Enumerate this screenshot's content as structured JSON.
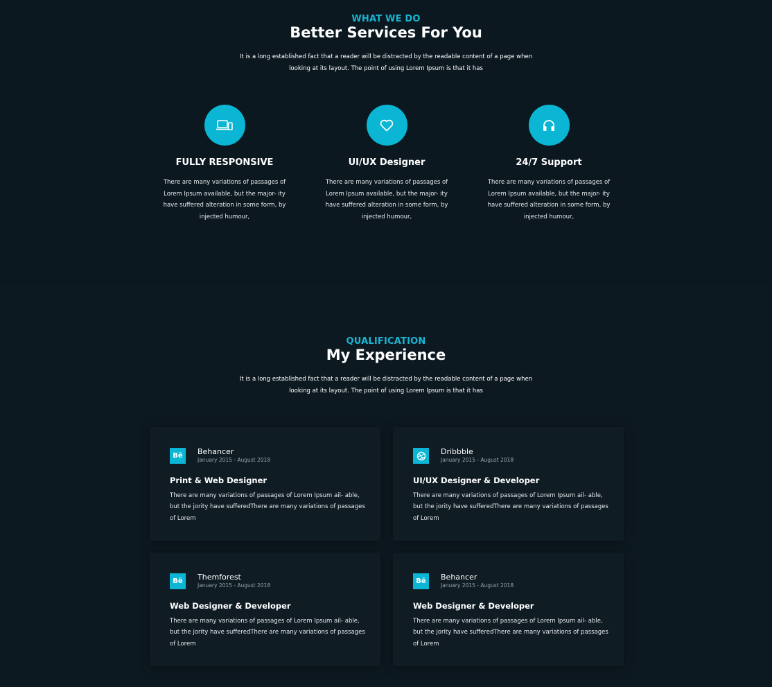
{
  "services_section": {
    "eyebrow": "WHAT WE DO",
    "heading": "Better Services For You",
    "lead_line1": "It is a long established fact that a reader will be distracted by the readable content of a page when",
    "lead_line2": "looking at its layout. The point of using Lorem Ipsum is that it has",
    "items": [
      {
        "icon": "devices-icon",
        "title": "FULLY RESPONSIVE",
        "desc": "There are many variations of passages of Lorem Ipsum available, but the major- ity have suffered alteration in some form, by injected humour,"
      },
      {
        "icon": "heart-icon",
        "title": "UI/UX Designer",
        "desc": "There are many variations of passages of Lorem Ipsum available, but the major- ity have suffered alteration in some form, by injected humour,"
      },
      {
        "icon": "headset-icon",
        "title": "24/7 Support",
        "desc": "There are many variations of passages of Lorem Ipsum available, but the major- ity have suffered alteration in some form, by injected humour,"
      }
    ]
  },
  "qualification_section": {
    "eyebrow": "QUALIFICATION",
    "heading": "My Experience",
    "lead_line1": "It is a long established fact that a reader will be distracted by the readable content of a page when",
    "lead_line2": "looking at its layout. The point of using Lorem Ipsum is that it has",
    "cards": [
      {
        "logo": "behance-icon",
        "logo_text": "Bē",
        "company": "Behancer",
        "dates": "January 2015 - August 2018",
        "role": "Print & Web Designer",
        "text": "There are many variations of passages of Lorem Ipsum ail- able, but the jority have sufferedThere are many variations of passages of Lorem"
      },
      {
        "logo": "dribbble-icon",
        "logo_text": "",
        "company": "Dribbble",
        "dates": "January 2015 - August 2018",
        "role": "UI/UX Designer & Developer",
        "text": "There are many variations of passages of Lorem Ipsum ail- able, but the jority have sufferedThere are many variations of passages of Lorem"
      },
      {
        "logo": "behance-icon",
        "logo_text": "Bē",
        "company": "Themforest",
        "dates": "January 2015 - August 2018",
        "role": "Web Designer & Developer",
        "text": "There are many variations of passages of Lorem Ipsum ail- able, but the jority have sufferedThere are many variations of passages of Lorem"
      },
      {
        "logo": "behance-icon",
        "logo_text": "Bē",
        "company": "Behancer",
        "dates": "January 2015 - August 2018",
        "role": "Web Designer & Developer",
        "text": "There are many variations of passages of Lorem Ipsum ail- able, but the jority have sufferedThere are many variations of passages of Lorem"
      }
    ]
  },
  "colors": {
    "accent": "#0ab6d4",
    "background": "#0b1820",
    "card_background": "#0f1c24",
    "text": "#ffffff"
  }
}
